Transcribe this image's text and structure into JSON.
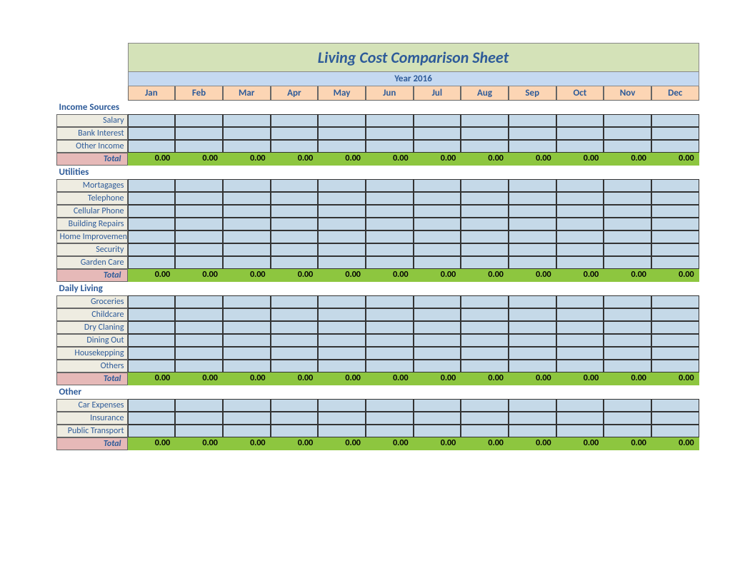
{
  "title": "Living Cost Comparison Sheet",
  "year": "Year 2016",
  "months": [
    "Jan",
    "Feb",
    "Mar",
    "Apr",
    "May",
    "Jun",
    "Jul",
    "Aug",
    "Sep",
    "Oct",
    "Nov",
    "Dec"
  ],
  "total_label": "Total",
  "sections": {
    "income": {
      "header": "Income Sources",
      "rows": [
        "Salary",
        "Bank Interest",
        "Other Income"
      ],
      "totals": [
        "0.00",
        "0.00",
        "0.00",
        "0.00",
        "0.00",
        "0.00",
        "0.00",
        "0.00",
        "0.00",
        "0.00",
        "0.00",
        "0.00"
      ]
    },
    "utilities": {
      "header": "Utilities",
      "rows": [
        "Mortagages",
        "Telephone",
        "Cellular Phone",
        "Building Repairs",
        "Home Improvement",
        "Security",
        "Garden Care"
      ],
      "totals": [
        "0.00",
        "0.00",
        "0.00",
        "0.00",
        "0.00",
        "0.00",
        "0.00",
        "0.00",
        "0.00",
        "0.00",
        "0.00",
        "0.00"
      ]
    },
    "daily": {
      "header": "Daily Living",
      "rows": [
        "Groceries",
        "Childcare",
        "Dry Claning",
        "Dining Out",
        "Housekepping",
        "Others"
      ],
      "totals": [
        "0.00",
        "0.00",
        "0.00",
        "0.00",
        "0.00",
        "0.00",
        "0.00",
        "0.00",
        "0.00",
        "0.00",
        "0.00",
        "0.00"
      ]
    },
    "other": {
      "header": "Other",
      "rows": [
        "Car Expenses",
        "Insurance",
        "Public Transport"
      ],
      "totals": [
        "0.00",
        "0.00",
        "0.00",
        "0.00",
        "0.00",
        "0.00",
        "0.00",
        "0.00",
        "0.00",
        "0.00",
        "0.00",
        "0.00"
      ]
    }
  }
}
